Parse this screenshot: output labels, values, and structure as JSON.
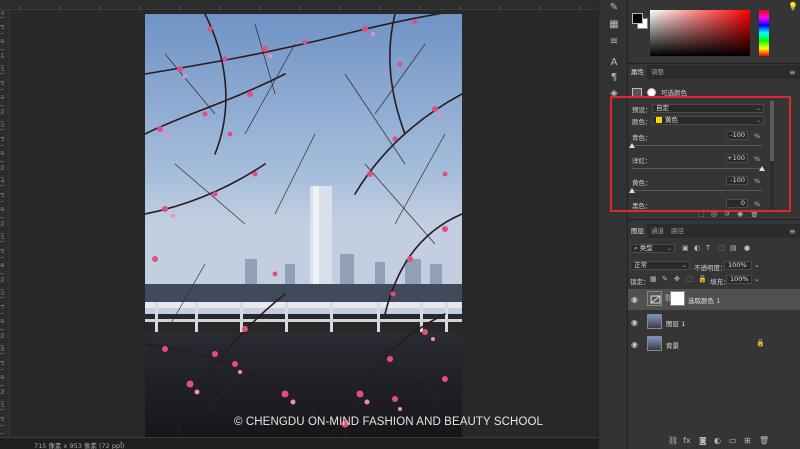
{
  "ruler": {
    "left_labels": [
      "0",
      "5",
      "0",
      "1",
      "5",
      "0",
      "2",
      "5",
      "0",
      "3",
      "5",
      "0",
      "4",
      "5",
      "0",
      "5",
      "5",
      "0",
      "6",
      "5",
      "0",
      "7",
      "5",
      "0",
      "8",
      "5",
      "0",
      "9",
      "5",
      "0"
    ]
  },
  "watermark": "© CHENGDU ON-MIND FASHION AND BEAUTY SCHOOL",
  "status_bar": {
    "doc_info": "715 像素 x 953 像素 (72 ppi)",
    "arrow": "›"
  },
  "colors": {
    "foreground": "#000000",
    "background": "#ffffff",
    "highlight_box": "#e0262e",
    "accent_yellow": "#ffd800"
  },
  "properties": {
    "tabs": [
      "属性",
      "调整"
    ],
    "header_title": "可选颜色",
    "preset_label": "预设：",
    "preset_value": "自定",
    "colors_label": "颜色：",
    "colors_value": "黄色",
    "sliders": [
      {
        "label": "青色：",
        "value": "-100",
        "unit": "%",
        "level": -100
      },
      {
        "label": "洋红：",
        "value": "+100",
        "unit": "%",
        "level": 100
      },
      {
        "label": "黄色：",
        "value": "-100",
        "unit": "%",
        "level": -100
      },
      {
        "label": "黑色：",
        "value": "0",
        "unit": "%",
        "level": 0
      }
    ]
  },
  "layers": {
    "tabs": [
      "图层",
      "通道",
      "路径"
    ],
    "filter_label": "类型",
    "blend_mode": "正常",
    "opacity_label": "不透明度：",
    "opacity_value": "100%",
    "lock_label": "锁定：",
    "fill_label": "填充：",
    "fill_value": "100%",
    "items": [
      {
        "name": "选取颜色 1",
        "selected": true
      },
      {
        "name": "图层 1",
        "selected": false
      },
      {
        "name": "背景",
        "selected": false,
        "locked": true
      }
    ]
  },
  "icons": {
    "eye": "eye-icon",
    "lock": "lock-icon",
    "menu": "panel-menu-icon"
  }
}
